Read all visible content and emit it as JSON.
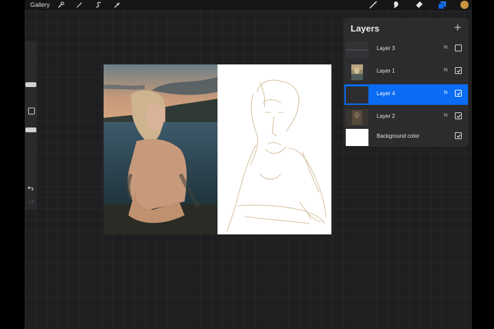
{
  "topbar": {
    "gallery_label": "Gallery",
    "left_icons": [
      "wrench-icon",
      "magic-wand-icon",
      "selection-icon",
      "transform-arrow-icon"
    ],
    "right_icons": [
      "brush-icon",
      "smudge-icon",
      "eraser-icon",
      "layers-icon",
      "color-swatch-icon"
    ],
    "active_color": "#c9953f",
    "accent_color": "#0a6cf2"
  },
  "sidebar": {
    "brush_size_level": 0.36,
    "opacity_level": 0.58,
    "icons": [
      "modify-square-icon",
      "undo-icon",
      "redo-icon"
    ]
  },
  "layers_panel": {
    "title": "Layers",
    "add_icon": "plus-icon",
    "layers": [
      {
        "name": "Layer 3",
        "blend": "N",
        "visible": false,
        "selected": false
      },
      {
        "name": "Layer 1",
        "blend": "N",
        "visible": true,
        "selected": false
      },
      {
        "name": "Layer 4",
        "blend": "N",
        "visible": true,
        "selected": true
      },
      {
        "name": "Layer 2",
        "blend": "N",
        "visible": true,
        "selected": false
      },
      {
        "name": "Background color",
        "blend": "",
        "visible": true,
        "selected": false
      }
    ]
  }
}
